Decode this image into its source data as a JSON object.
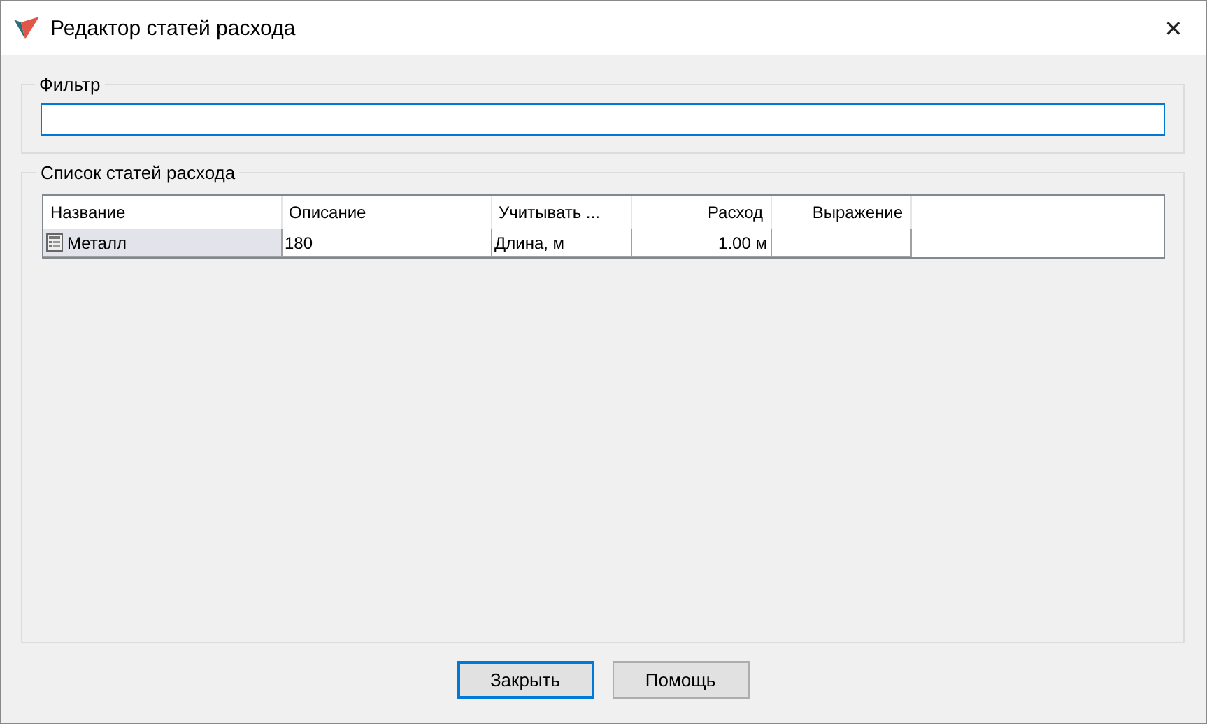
{
  "window": {
    "title": "Редактор статей расхода",
    "close": "✕"
  },
  "filter": {
    "legend": "Фильтр"
  },
  "list": {
    "legend": "Список статей расхода",
    "columns": [
      {
        "label": "Название",
        "kind": "text"
      },
      {
        "label": "Описание",
        "kind": "text"
      },
      {
        "label": "Учитывать ...",
        "kind": "text"
      },
      {
        "label": "Расход",
        "kind": "number"
      },
      {
        "label": "Выражение",
        "kind": "number"
      }
    ],
    "rows": [
      {
        "selected": true,
        "cells": [
          "Металл",
          "180",
          "Длина, м",
          "1.00 м",
          null
        ]
      }
    ]
  },
  "buttons": [
    {
      "label": "Закрыть",
      "default": true
    },
    {
      "label": "Помощь",
      "default": false
    }
  ]
}
